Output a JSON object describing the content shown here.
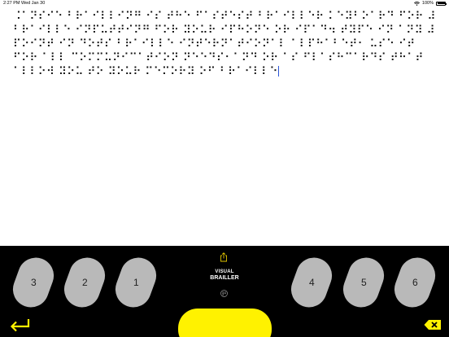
{
  "status_bar": {
    "time": "2:27 PM",
    "date": "Wed Jan 30",
    "battery": "100%",
    "battery_level": 1.0
  },
  "document": {
    "lines": [
      "⠨⠁⠝⠎⠊⠑ ⠃⠗⠁⠊⠇⠇⠊⠝⠛ ⠊⠎ ⠞⠓⠑ ⠋⠁⠎⠞⠑⠎⠞ ⠃⠗⠁⠊⠇⠇⠑⠗ ⠅⠑⠽⠃⠕⠁⠗⠙ ⠋⠕⠗ ⠼",
      "⠃⠗⠁⠊⠇⠇⠑ ⠊⠝⠏⠥⠞⠞⠊⠝⠛ ⠋⠕⠗ ⠽⠕⠥⠗ ⠊⠏⠓⠕⠝⠑ ⠕⠗ ⠊⠏⠁⠙⠲ ⠞⠽⠏⠑ ⠊⠝ ⠁⠝⠽ ⠼",
      "⠏⠕⠊⠝⠞ ⠊⠝ ⠙⠕⠞⠎ ⠃⠗⠁⠊⠇⠇⠑ ⠊⠝⠞⠑⠗⠝⠁⠞⠊⠕⠝⠁⠇ ⠁⠇⠏⠓⠁⠃⠑⠞⠂ ⠥⠎⠑ ⠊⠞",
      "⠋⠕⠗ ⠁⠇⠇ ⠉⠕⠍⠍⠥⠝⠊⠉⠁⠞⠊⠕⠝ ⠝⠑⠑⠙⠎⠂⠁⠝⠙ ⠕⠗ ⠁⠎ ⠋⠇⠁⠎⠓⠉⠁⠗⠙⠎ ⠞⠓⠁⠞",
      "⠁⠇⠇⠕⠺ ⠽⠕⠥ ⠞⠕ ⠽⠕⠥⠗ ⠍⠑⠍⠕⠗⠽ ⠕⠋ ⠃⠗⠁⠊⠇⠇⠑"
    ]
  },
  "keyboard": {
    "keys_left": [
      "3",
      "2",
      "1"
    ],
    "keys_right": [
      "4",
      "5",
      "6"
    ],
    "logo_line1": "VISUAL",
    "logo_line2": "BRAILLER"
  },
  "icons": {
    "share": "share-icon",
    "braille_logo": "braille-cell-icon",
    "return": "return-arrow-icon",
    "delete": "delete-backspace-icon",
    "wifi": "wifi-icon",
    "battery": "battery-icon"
  },
  "colors": {
    "keyboard_bg": "#000000",
    "dot_key": "#b9b9b9",
    "accent_yellow": "#fff200",
    "cursor": "#2a55d6"
  }
}
